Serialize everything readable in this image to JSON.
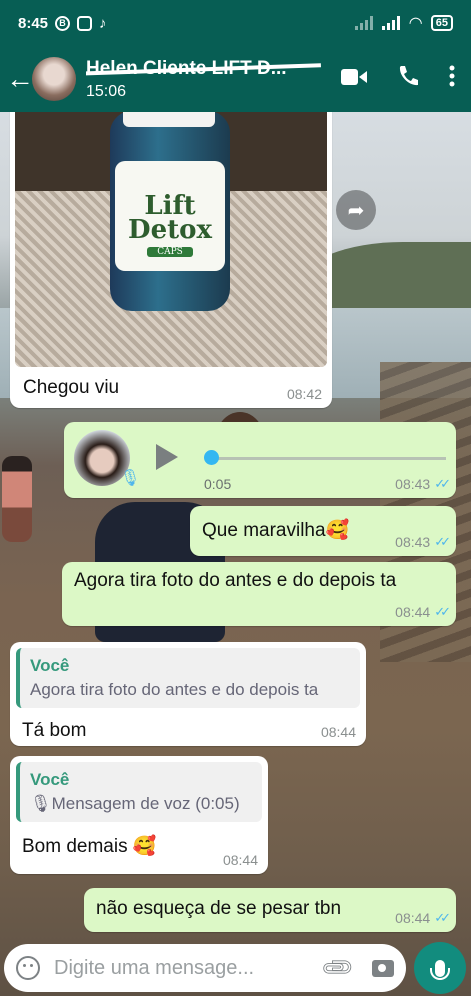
{
  "status_bar": {
    "time": "8:45",
    "battery": "65"
  },
  "header": {
    "contact_name": "Helen Cliente LIFT D...",
    "subtitle": "15:06"
  },
  "messages": [
    {
      "type": "image",
      "direction": "in",
      "caption": "Chegou viu",
      "time": "08:42",
      "image_label": {
        "line1": "Lift",
        "line2": "Detox",
        "line3": "CAPS"
      }
    },
    {
      "type": "voice",
      "direction": "out",
      "duration": "0:05",
      "time": "08:43"
    },
    {
      "type": "text",
      "direction": "out",
      "text": "Que maravilha🥰",
      "time": "08:43"
    },
    {
      "type": "text",
      "direction": "out",
      "text": "Agora tira foto do antes e do depois ta",
      "time": "08:44"
    },
    {
      "type": "reply",
      "direction": "in",
      "quote_author": "Você",
      "quote_text": "Agora tira foto do antes e do depois ta",
      "text": "Tá bom",
      "time": "08:44"
    },
    {
      "type": "reply",
      "direction": "in",
      "quote_author": "Você",
      "quote_text": "Mensagem de voz (0:05)",
      "text": "Bom demais 🥰",
      "time": "08:44"
    },
    {
      "type": "text",
      "direction": "out",
      "text": "não esqueça de se pesar tbn",
      "time": "08:44"
    }
  ],
  "input": {
    "placeholder": "Digite uma mensage..."
  },
  "icons": {
    "back": "arrow-left-icon",
    "video": "video-call-icon",
    "call": "phone-icon",
    "menu": "more-vert-icon",
    "emoji": "emoji-icon",
    "attach": "paperclip-icon",
    "camera": "camera-icon",
    "mic": "mic-icon",
    "forward": "forward-icon"
  },
  "colors": {
    "header": "#075e54",
    "outgoing_bubble": "#dcf8c6",
    "incoming_bubble": "#ffffff",
    "read_ticks": "#4fb6ec",
    "mic_button": "#128c7e"
  }
}
